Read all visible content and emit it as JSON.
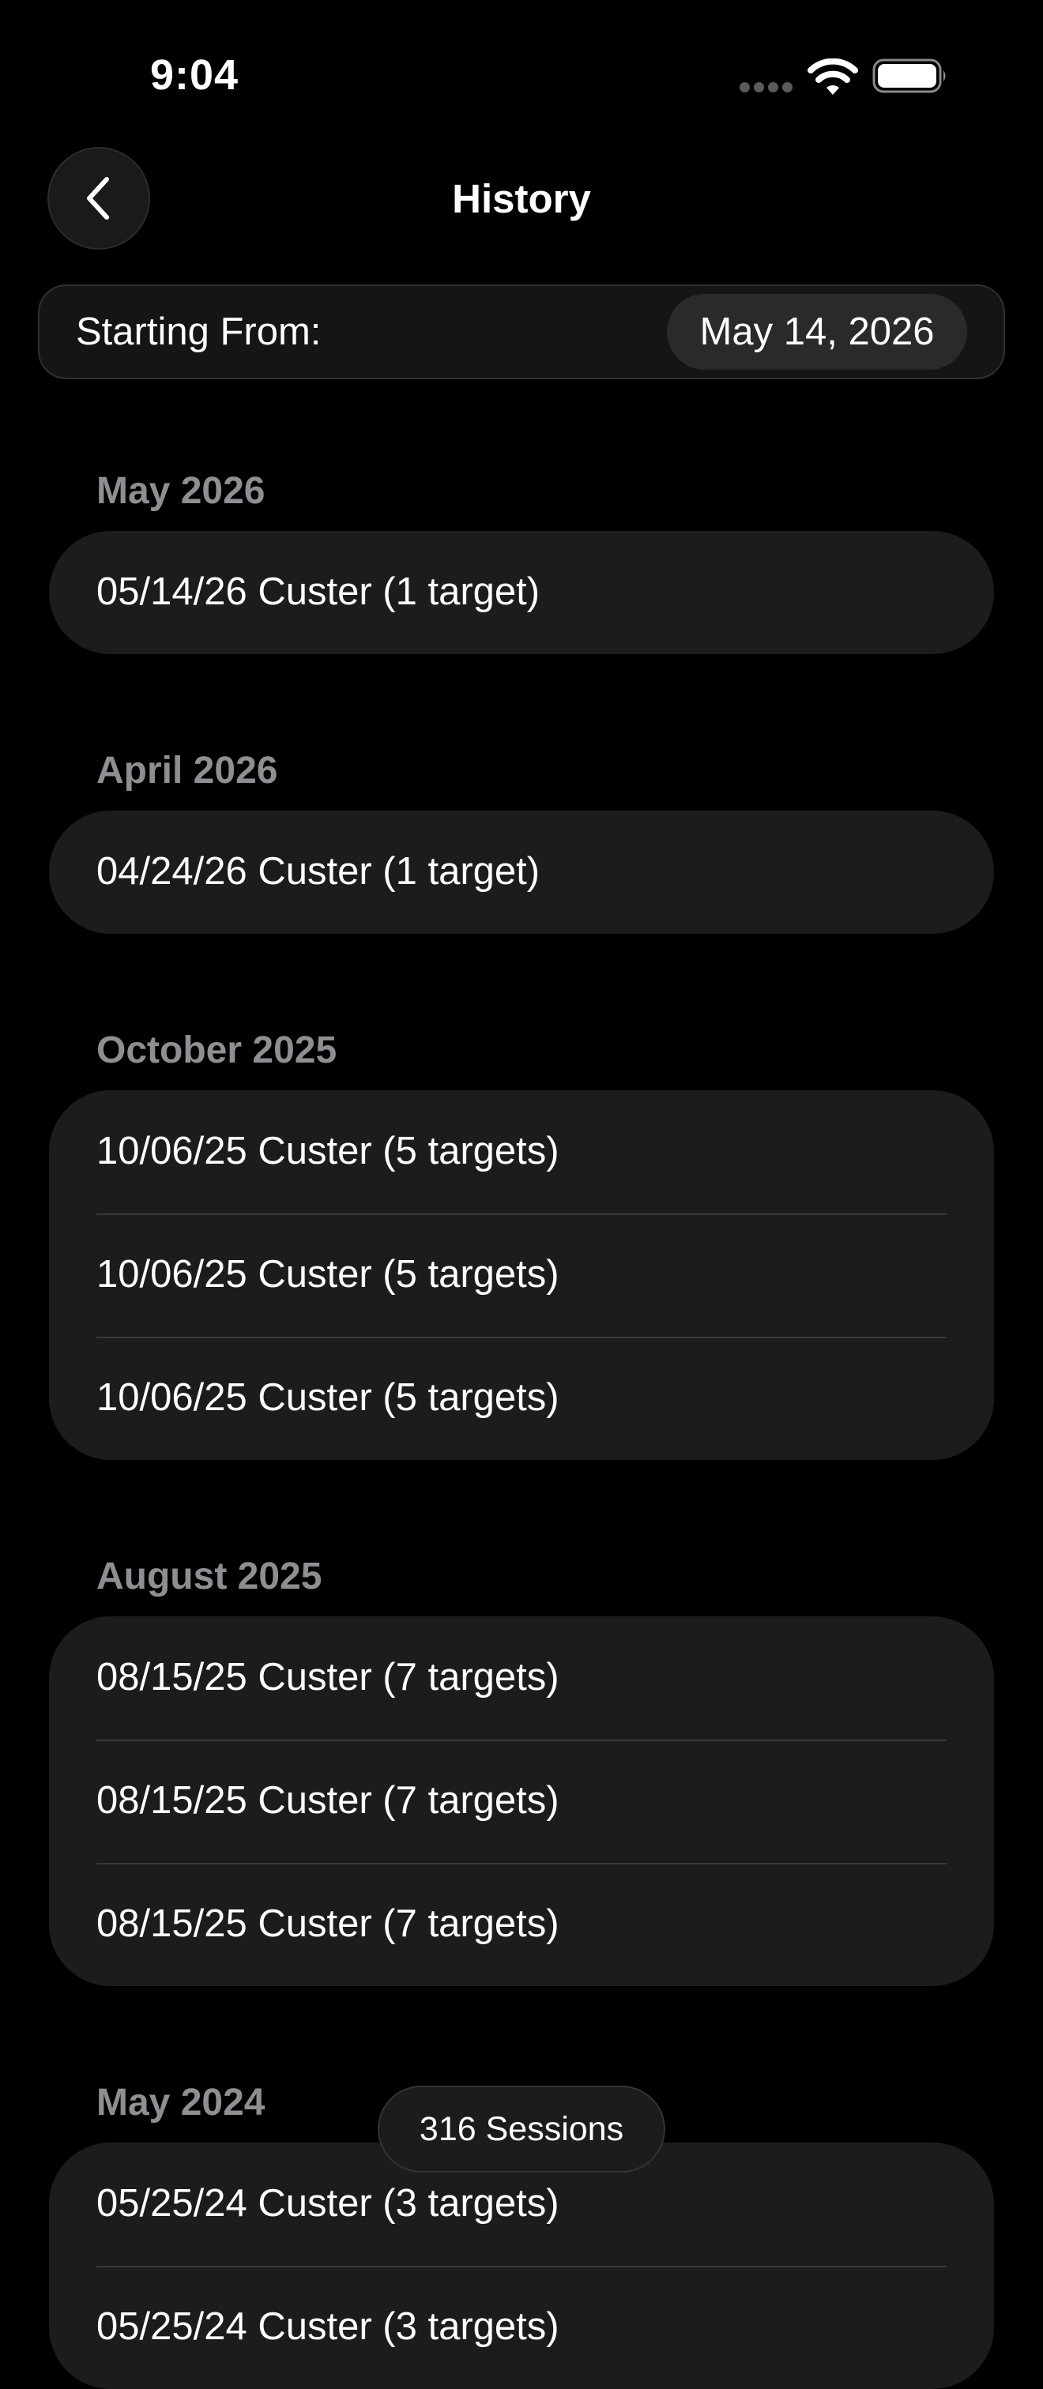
{
  "status_bar": {
    "time": "9:04"
  },
  "nav": {
    "title": "History"
  },
  "filter": {
    "label": "Starting From:",
    "date": "May 14, 2026"
  },
  "sections": [
    {
      "title": "May 2026",
      "rows": [
        "05/14/26 Custer (1 target)"
      ]
    },
    {
      "title": "April 2026",
      "rows": [
        "04/24/26 Custer (1 target)"
      ]
    },
    {
      "title": "October 2025",
      "rows": [
        "10/06/25 Custer (5 targets)",
        "10/06/25 Custer (5 targets)",
        "10/06/25 Custer (5 targets)"
      ]
    },
    {
      "title": "August 2025",
      "rows": [
        "08/15/25 Custer (7 targets)",
        "08/15/25 Custer (7 targets)",
        "08/15/25 Custer (7 targets)"
      ]
    },
    {
      "title": "May 2024",
      "rows": [
        "05/25/24 Custer (3 targets)",
        "05/25/24 Custer (3 targets)"
      ]
    }
  ],
  "footer": {
    "sessions_count": "316 Sessions"
  },
  "colors": {
    "background": "#000000",
    "group_background": "#1c1c1e",
    "section_header": "#8e8e93",
    "separator": "#3a3a3c"
  }
}
